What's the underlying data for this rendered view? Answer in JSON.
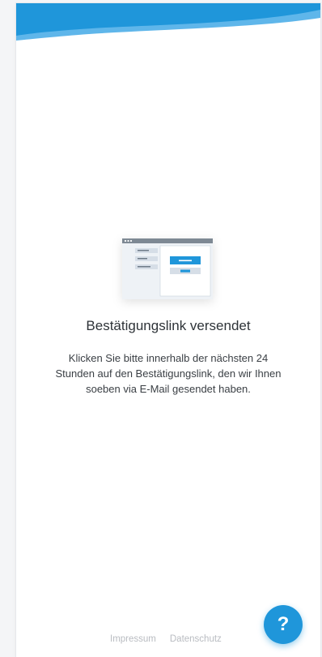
{
  "header": {
    "wave_color": "#1f96da",
    "wave_color_light": "#5fb6ea"
  },
  "main": {
    "illustration_icon": "browser-window-illustration",
    "title": "Bestätigungslink versendet",
    "description": "Klicken Sie bitte innerhalb der nächsten 24 Stunden auf den Bestätigungslink, den wir Ihnen soeben via E-Mail gesendet haben."
  },
  "footer": {
    "impressum_label": "Impressum",
    "datenschutz_label": "Datenschutz"
  },
  "help_button": {
    "label": "?",
    "color": "#1f96da"
  }
}
